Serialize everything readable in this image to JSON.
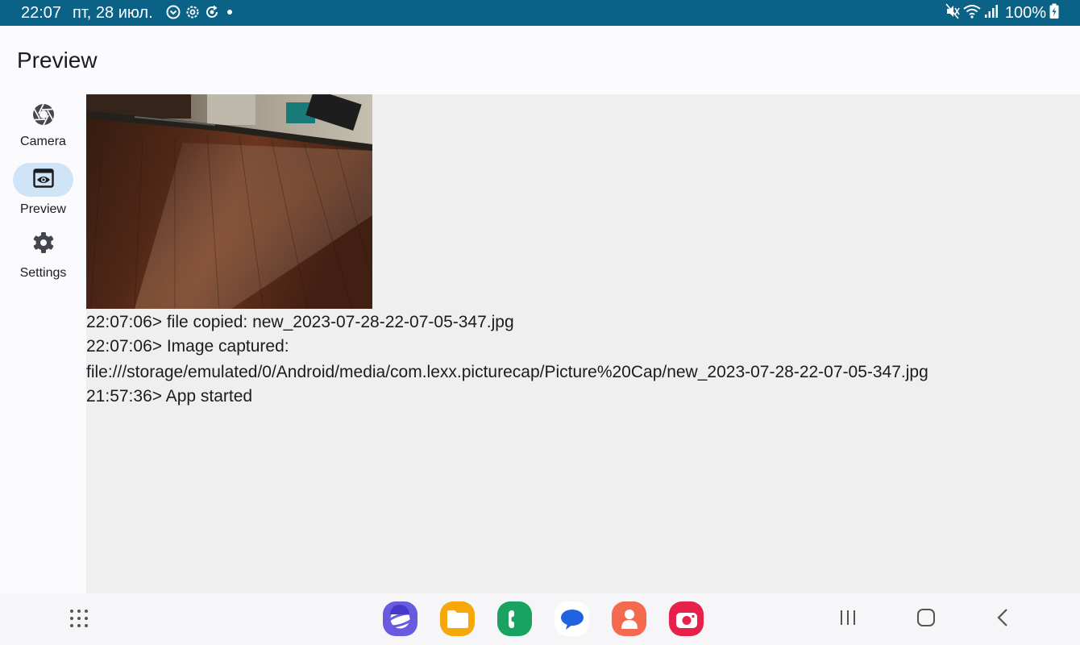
{
  "status_bar": {
    "time": "22:07",
    "date": "пт, 28 июл.",
    "notification_icons": [
      "shield-check-icon",
      "gear-icon",
      "refresh-shield-icon",
      "dot-icon"
    ],
    "system_icons": [
      "mute-icon",
      "wifi-icon",
      "signal-icon",
      "battery-charging-icon"
    ],
    "battery": "100%",
    "color": "#0b6287"
  },
  "app_bar": {
    "title": "Preview"
  },
  "nav_rail": {
    "items": [
      {
        "label": "Camera",
        "icon": "camera-shutter-icon",
        "active": false
      },
      {
        "label": "Preview",
        "icon": "preview-eye-icon",
        "active": true
      },
      {
        "label": "Settings",
        "icon": "gear-icon",
        "active": false
      }
    ],
    "active_color": "#cfe4f6"
  },
  "main": {
    "log": [
      "22:07:06> file copied: new_2023-07-28-22-07-05-347.jpg",
      "22:07:06> Image captured:",
      "file:///storage/emulated/0/Android/media/com.lexx.picturecap/Picture%20Cap/new_2023-07-28-22-07-05-347.jpg",
      "21:57:36> App started"
    ]
  },
  "bottom_bar": {
    "dock_apps": [
      {
        "name": "samsung-internet-icon",
        "color": "#6a5ae0"
      },
      {
        "name": "my-files-icon",
        "color": "#f7a70a"
      },
      {
        "name": "phone-icon",
        "color": "#1aa260"
      },
      {
        "name": "messages-icon",
        "color": "#ffffff"
      },
      {
        "name": "contacts-icon",
        "color": "#f46a4e"
      },
      {
        "name": "camera-app-icon",
        "color": "#e8214b"
      }
    ],
    "nav_buttons": [
      "recents-icon",
      "home-icon",
      "back-icon"
    ]
  }
}
